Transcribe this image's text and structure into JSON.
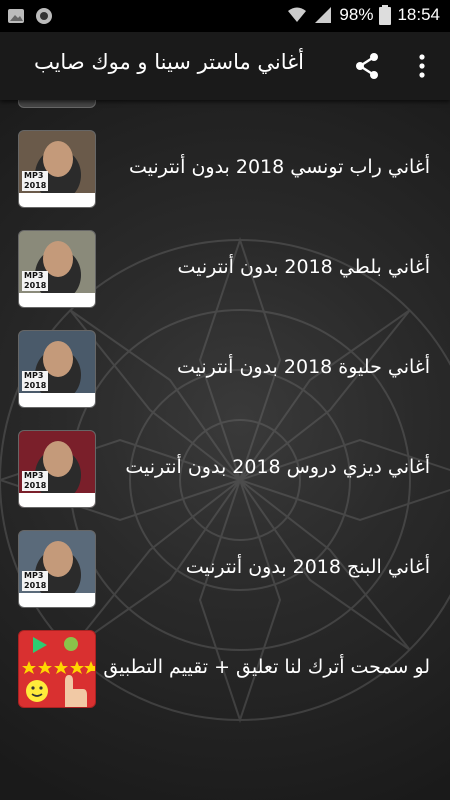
{
  "status": {
    "battery": "98%",
    "time": "18:54"
  },
  "appbar": {
    "title": "أغاني ماستر سينا و موك صايب"
  },
  "items": [
    {
      "label": "أغاني راب تونسي 2018 بدون أنترنيت",
      "thumb_color": "#6a5a4a"
    },
    {
      "label": "أغاني بلطي 2018 بدون أنترنيت",
      "thumb_color": "#8a8a7a"
    },
    {
      "label": "أغاني حليوة 2018 بدون أنترنيت",
      "thumb_color": "#4a5a6a"
    },
    {
      "label": "أغاني ديزي دروس 2018 بدون أنترنيت",
      "thumb_color": "#7a1f2a"
    },
    {
      "label": "أغاني البنج 2018 بدون أنترنيت",
      "thumb_color": "#5a6a7a"
    }
  ],
  "rate": {
    "label": "لو سمحت أترك لنا تعليق + تقييم التطبيق"
  }
}
